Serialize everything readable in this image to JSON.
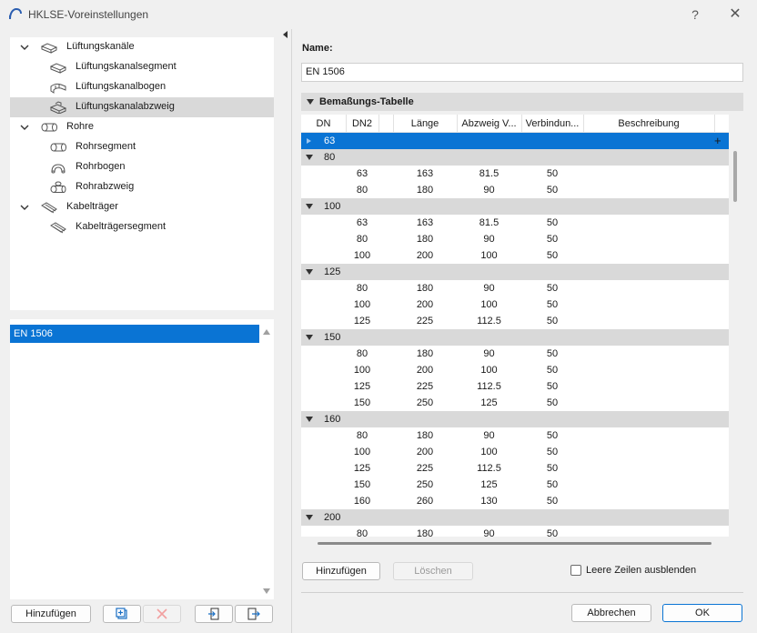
{
  "window": {
    "title": "HKLSE-Voreinstellungen",
    "help_glyph": "?",
    "close_glyph": "✕"
  },
  "tree": [
    {
      "label": "Lüftungskanäle",
      "level": 0,
      "expanded": true,
      "icon": "duct-icon"
    },
    {
      "label": "Lüftungskanalsegment",
      "level": 1,
      "icon": "duct-segment-icon"
    },
    {
      "label": "Lüftungskanalbogen",
      "level": 1,
      "icon": "duct-bend-icon"
    },
    {
      "label": "Lüftungskanalabzweig",
      "level": 1,
      "icon": "duct-branch-icon",
      "selected": true
    },
    {
      "label": "Rohre",
      "level": 0,
      "expanded": true,
      "icon": "pipe-icon"
    },
    {
      "label": "Rohrsegment",
      "level": 1,
      "icon": "pipe-segment-icon"
    },
    {
      "label": "Rohrbogen",
      "level": 1,
      "icon": "pipe-bend-icon"
    },
    {
      "label": "Rohrabzweig",
      "level": 1,
      "icon": "pipe-branch-icon"
    },
    {
      "label": "Kabelträger",
      "level": 0,
      "expanded": true,
      "icon": "cable-tray-icon"
    },
    {
      "label": "Kabelträgersegment",
      "level": 1,
      "icon": "cable-tray-segment-icon"
    }
  ],
  "list": {
    "items": [
      "EN 1506"
    ],
    "selected_index": 0
  },
  "left_buttons": {
    "add_label": "Hinzufügen",
    "icons": [
      "duplicate-icon",
      "delete-icon",
      "import-icon",
      "export-icon"
    ]
  },
  "right": {
    "name_label": "Name:",
    "name_value": "EN 1506",
    "section_title": "Bemaßungs-Tabelle",
    "columns": [
      "DN",
      "DN2",
      "",
      "Länge",
      "Abzweig V...",
      "Verbindun...",
      "Beschreibung"
    ],
    "selected_row": "63",
    "groups": [
      {
        "dn": "80",
        "rows": [
          [
            "63",
            "163",
            "81.5",
            "50"
          ],
          [
            "80",
            "180",
            "90",
            "50"
          ]
        ]
      },
      {
        "dn": "100",
        "rows": [
          [
            "63",
            "163",
            "81.5",
            "50"
          ],
          [
            "80",
            "180",
            "90",
            "50"
          ],
          [
            "100",
            "200",
            "100",
            "50"
          ]
        ]
      },
      {
        "dn": "125",
        "rows": [
          [
            "80",
            "180",
            "90",
            "50"
          ],
          [
            "100",
            "200",
            "100",
            "50"
          ],
          [
            "125",
            "225",
            "112.5",
            "50"
          ]
        ]
      },
      {
        "dn": "150",
        "rows": [
          [
            "80",
            "180",
            "90",
            "50"
          ],
          [
            "100",
            "200",
            "100",
            "50"
          ],
          [
            "125",
            "225",
            "112.5",
            "50"
          ],
          [
            "150",
            "250",
            "125",
            "50"
          ]
        ]
      },
      {
        "dn": "160",
        "rows": [
          [
            "80",
            "180",
            "90",
            "50"
          ],
          [
            "100",
            "200",
            "100",
            "50"
          ],
          [
            "125",
            "225",
            "112.5",
            "50"
          ],
          [
            "150",
            "250",
            "125",
            "50"
          ],
          [
            "160",
            "260",
            "130",
            "50"
          ]
        ]
      },
      {
        "dn": "200",
        "rows": [
          [
            "80",
            "180",
            "90",
            "50"
          ]
        ]
      }
    ],
    "add_row_label": "Hinzufügen",
    "delete_row_label": "Löschen",
    "hide_empty_label": "Leere Zeilen ausblenden",
    "hide_empty_checked": false,
    "cancel_label": "Abbrechen",
    "ok_label": "OK"
  },
  "colors": {
    "accent": "#0a74d4",
    "group_row": "#d9d9d9",
    "selected_tree": "#d9d9d9"
  }
}
